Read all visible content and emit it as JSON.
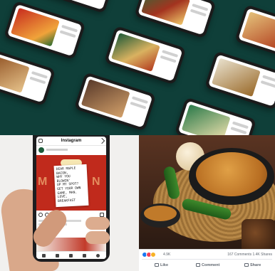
{
  "instagram": {
    "app_title": "Instagram",
    "note_lines": [
      "Dear Maple Bacon,",
      "Why you blowin'",
      "up my spot?",
      "Get your own",
      "game, man.",
      "Love,",
      "Breakfast"
    ]
  },
  "facebook": {
    "reactions_count": "4.9K",
    "meta": "167 Comments  1.4K Shares",
    "buttons": [
      "Like",
      "Comment",
      "Share"
    ]
  },
  "colors": {
    "top_background": "#0f3f39",
    "post_red": "#c02a1c",
    "brand_green": "#1c5a3a"
  }
}
